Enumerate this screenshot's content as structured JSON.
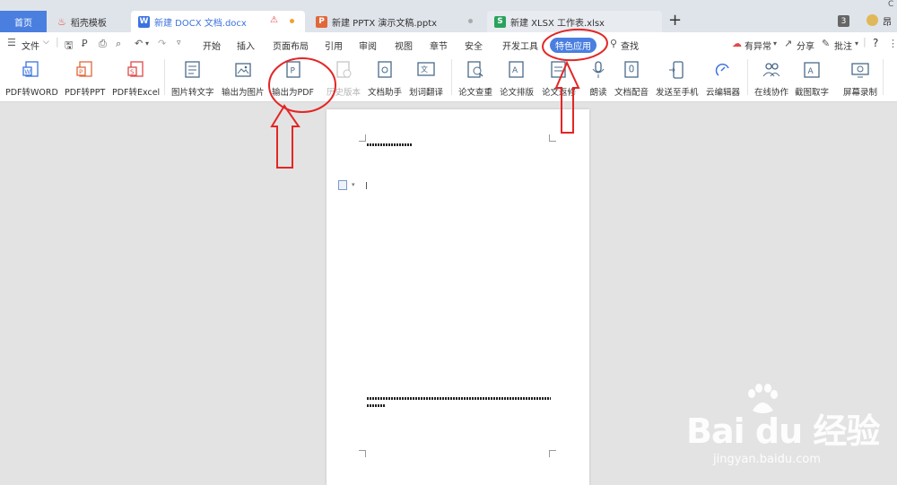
{
  "tabs": {
    "home": "首页",
    "items": [
      {
        "label": "稻壳模板",
        "icon": "daoke-flame-icon",
        "color": "#e8483a"
      },
      {
        "label": "新建 DOCX 文档.docx",
        "icon": "docx-icon",
        "color": "#3b72e0",
        "active": true
      },
      {
        "label": "新建 PPTX 演示文稿.pptx",
        "icon": "pptx-icon",
        "color": "#e0683a"
      },
      {
        "label": "新建 XLSX 工作表.xlsx",
        "icon": "xlsx-icon",
        "color": "#2aa25e"
      }
    ],
    "doc_letter": "W",
    "ppt_letter": "P",
    "xls_letter": "S",
    "add": "+",
    "count_badge": "3",
    "user_label": "昂",
    "corner_text": "C"
  },
  "menu": {
    "file": "文件",
    "items": [
      "开始",
      "插入",
      "页面布局",
      "引用",
      "审阅",
      "视图",
      "章节",
      "安全",
      "开发工具"
    ],
    "special": "特色应用",
    "search": "查找",
    "right": {
      "sync": "有异常",
      "share": "分享",
      "comment": "批注",
      "help": "?"
    }
  },
  "ribbon": [
    {
      "label": "PDF转WORD",
      "icon": "pdf-to-word-icon"
    },
    {
      "label": "PDF转PPT",
      "icon": "pdf-to-ppt-icon"
    },
    {
      "label": "PDF转Excel",
      "icon": "pdf-to-excel-icon"
    },
    {
      "label": "图片转文字",
      "icon": "image-to-text-icon"
    },
    {
      "label": "输出为图片",
      "icon": "export-image-icon"
    },
    {
      "label": "输出为PDF",
      "icon": "export-pdf-icon"
    },
    {
      "label": "历史版本",
      "icon": "history-version-icon",
      "disabled": true
    },
    {
      "label": "文档助手",
      "icon": "doc-assistant-icon"
    },
    {
      "label": "划词翻译",
      "icon": "translate-icon"
    },
    {
      "label": "论文查重",
      "icon": "plagiarism-check-icon"
    },
    {
      "label": "论文排版",
      "icon": "paper-layout-icon"
    },
    {
      "label": "论文返修",
      "icon": "paper-revise-icon"
    },
    {
      "label": "朗读",
      "icon": "read-aloud-icon"
    },
    {
      "label": "文档配音",
      "icon": "doc-dubbing-icon"
    },
    {
      "label": "发送至手机",
      "icon": "send-to-phone-icon"
    },
    {
      "label": "云编辑器",
      "icon": "cloud-editor-icon"
    },
    {
      "label": "在线协作",
      "icon": "online-collab-icon"
    },
    {
      "label": "截图取字",
      "icon": "screenshot-ocr-icon"
    },
    {
      "label": "屏幕录制",
      "icon": "screen-record-icon"
    }
  ],
  "watermark": {
    "logo": "Bai du 经验",
    "url": "jingyan.baidu.com"
  },
  "colors": {
    "accent": "#4a7fe0",
    "annotation": "#e32626"
  }
}
